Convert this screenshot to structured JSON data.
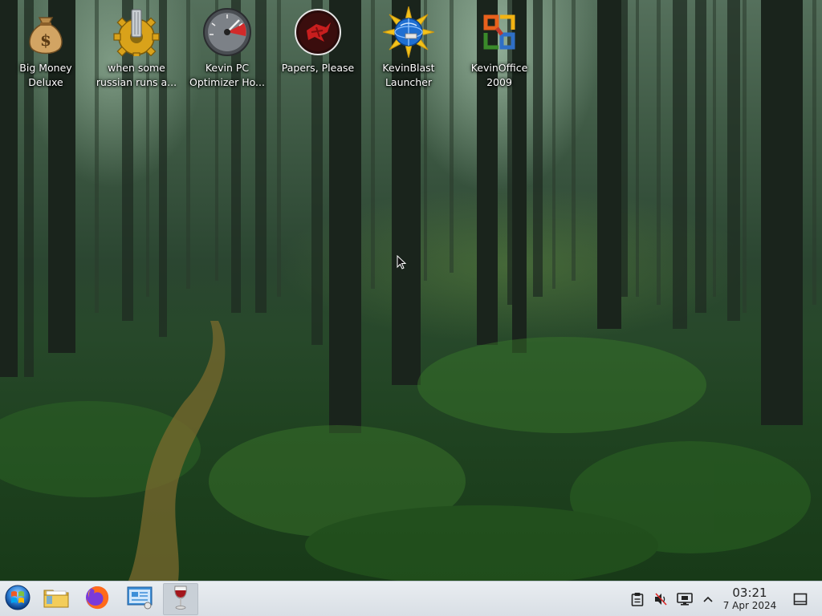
{
  "desktop": {
    "icons": [
      {
        "label_line1": "Big Money",
        "label_line2": "Deluxe",
        "icon": "money-bag-icon"
      },
      {
        "label_line1": "when some",
        "label_line2": "russian runs a...",
        "icon": "gear-icon"
      },
      {
        "label_line1": "Kevin PC",
        "label_line2": "Optimizer Ho...",
        "icon": "speedometer-icon"
      },
      {
        "label_line1": "Papers, Please",
        "label_line2": "",
        "icon": "papers-please-icon"
      },
      {
        "label_line1": "KevinBlast",
        "label_line2": "Launcher",
        "icon": "globe-star-icon"
      },
      {
        "label_line1": "KevinOffice",
        "label_line2": "2009",
        "icon": "office-logo-icon"
      }
    ]
  },
  "taskbar": {
    "buttons": [
      {
        "name": "start-menu",
        "icon": "windows-orb-icon"
      },
      {
        "name": "file-manager",
        "icon": "folder-icon"
      },
      {
        "name": "firefox",
        "icon": "firefox-icon"
      },
      {
        "name": "control-panel",
        "icon": "control-panel-icon"
      },
      {
        "name": "wine-app",
        "icon": "wine-glass-icon",
        "active": true
      }
    ],
    "tray": {
      "icons": [
        "clipboard-icon",
        "speaker-muted-icon",
        "display-icon",
        "chevron-up-icon",
        "show-desktop-icon"
      ]
    },
    "clock": {
      "time": "03:21",
      "date": "7 Apr 2024"
    }
  },
  "colors": {
    "taskbar_bg": "#e2e7ec",
    "label_text": "#ffffff",
    "wallpaper_base": "#27482a"
  }
}
